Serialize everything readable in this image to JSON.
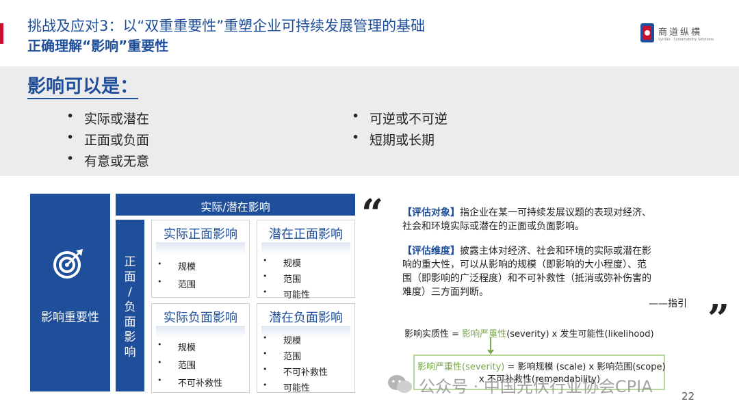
{
  "header": {
    "title_line1": "挑战及应对3：以“双重重要性”重塑企业可持续发展管理的基础",
    "title_line2": "正确理解“影响”重要性",
    "logo_text": "商道纵横",
    "logo_subtext": "SynTao · Sustainability Solutions"
  },
  "intro": {
    "heading": "影响可以是：",
    "bullets_left": [
      "实际或潜在",
      "正面或负面",
      "有意或无意"
    ],
    "bullets_right": [
      "可逆或不可逆",
      "短期或长期"
    ]
  },
  "diagram": {
    "left_label": "影响重要性",
    "top_band": "实际/潜在影响",
    "side_band": "正面/负面影响",
    "quadrants": [
      {
        "title": "实际正面影响",
        "items": [
          "规模",
          "范围"
        ]
      },
      {
        "title": "潜在正面影响",
        "items": [
          "规模",
          "范围",
          "可能性"
        ]
      },
      {
        "title": "实际负面影响",
        "items": [
          "规模",
          "范围",
          "不可补救性"
        ]
      },
      {
        "title": "潜在负面影响",
        "items": [
          "规模",
          "范围",
          "不可补救性",
          "可能性"
        ]
      }
    ]
  },
  "guidance": {
    "open_quote": "“",
    "close_quote": "”",
    "object_tag": "【评估对象】",
    "object_line1": "指企业在某一可持续发展议题的表现对经济、",
    "object_line2": "社会和环境实际或潜在的正面或负面影响。",
    "dimension_tag": "【评估维度】",
    "dimension_line1": "披露主体对经济、社会和环境的实际或潜在影",
    "dimension_line2": "响的重大性，可以从影响的规模（即影响的大小程度）、范",
    "dimension_line3": "围（即影响的广泛程度）和不可补救性（抵消或弥补伤害的",
    "dimension_line4": "难度）三方面判断。",
    "source": "——指引"
  },
  "formula": {
    "line1_prefix": "影响实质性 = ",
    "line1_term": "影响严重性",
    "line1_suffix": "(severity) x 发生可能性(likelihood)",
    "line2_term": "影响严重性(severity)",
    "line2_suffix": " = 影响规模 (scale) x 影响范围(scope)",
    "line3": "x 不可补救性(remendability)"
  },
  "footer": {
    "watermark": "公众号 · 中国光伏行业协会CPIA",
    "page_number": "22"
  },
  "colors": {
    "primary_blue": "#1f4e9a",
    "accent_red": "#c8102e",
    "formula_green": "#7aa94e"
  }
}
